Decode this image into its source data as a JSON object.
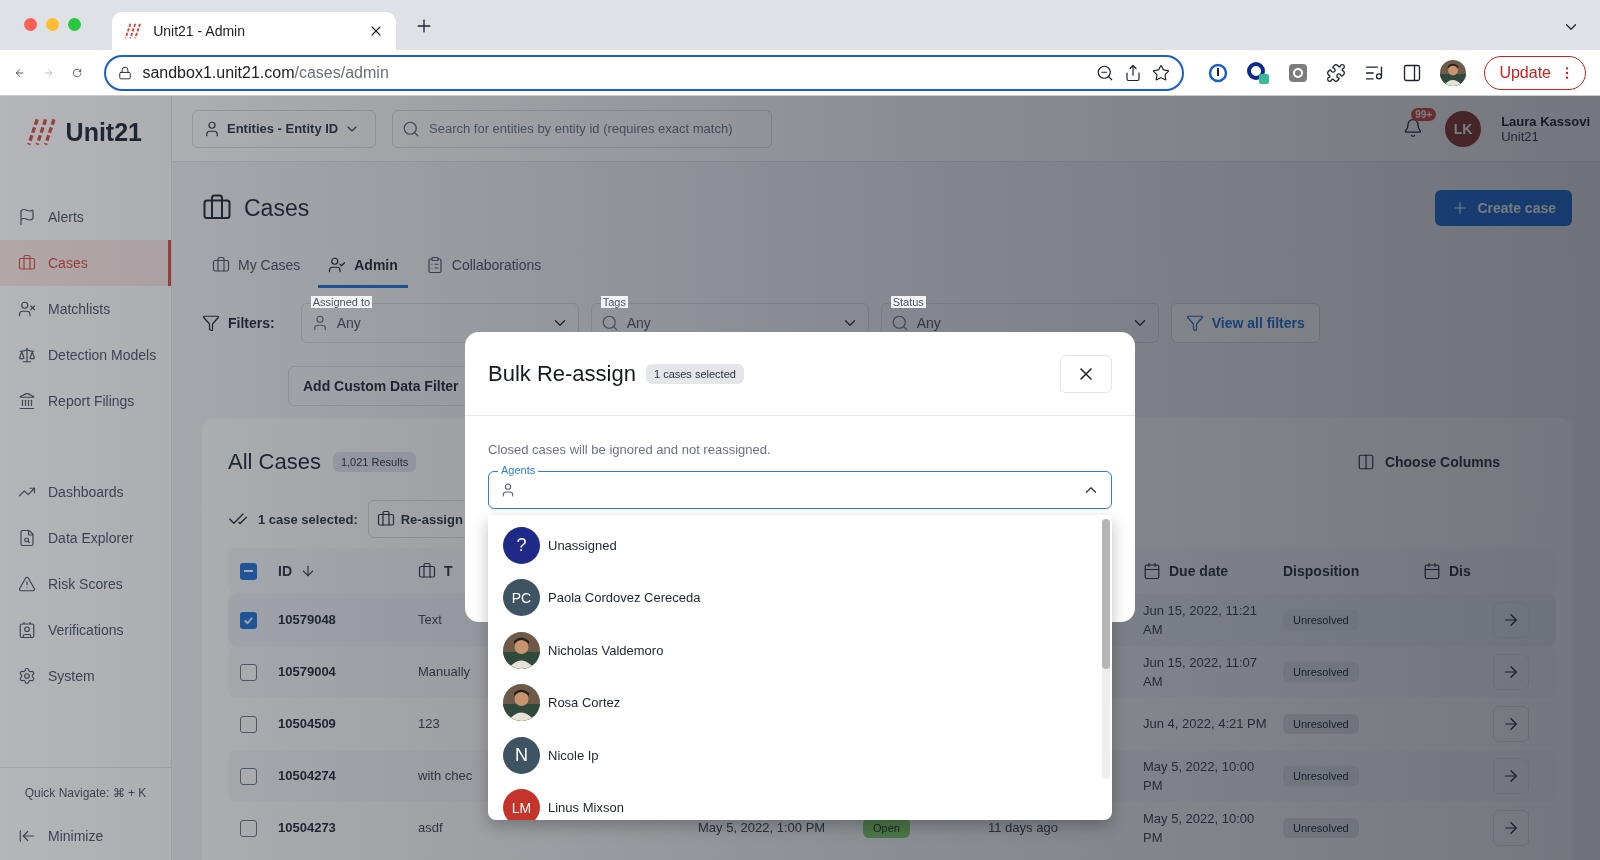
{
  "browser": {
    "tab_title": "Unit21 - Admin",
    "url_host": "sandbox1.unit21.com",
    "url_path": "/cases/admin",
    "update_button": "Update"
  },
  "sidebar": {
    "logo": "Unit21",
    "sections": [
      {
        "items": [
          {
            "label": "Alerts",
            "selected": false
          },
          {
            "label": "Cases",
            "selected": true
          },
          {
            "label": "Matchlists",
            "selected": false
          },
          {
            "label": "Detection Models",
            "selected": false
          },
          {
            "label": "Report Filings",
            "selected": false
          }
        ]
      },
      {
        "items": [
          {
            "label": "Dashboards",
            "selected": false
          },
          {
            "label": "Data Explorer",
            "selected": false
          },
          {
            "label": "Risk Scores",
            "selected": false
          },
          {
            "label": "Verifications",
            "selected": false
          },
          {
            "label": "System",
            "selected": false
          }
        ]
      }
    ],
    "quick_navigate": "Quick Navigate: ⌘ + K",
    "minimize": "Minimize"
  },
  "topbar": {
    "entity_selector": "Entities - Entity ID",
    "search": {
      "placeholder": "Search for entities by entity id (requires exact match)"
    },
    "notifications_badge": "99+",
    "user": {
      "initials": "LK",
      "name": "Laura Kassovi",
      "org": "Unit21"
    }
  },
  "page": {
    "title": "Cases",
    "create_button": "Create case",
    "tabs": [
      {
        "label": "My Cases",
        "selected": false
      },
      {
        "label": "Admin",
        "selected": true
      },
      {
        "label": "Collaborations",
        "selected": false
      }
    ],
    "filters": {
      "label": "Filters:",
      "fields": [
        {
          "label": "Assigned to",
          "value": "Any"
        },
        {
          "label": "Tags",
          "value": "Any"
        },
        {
          "label": "Status",
          "value": "Any"
        }
      ],
      "view_all": "View all filters",
      "add_custom": "Add Custom Data Filter"
    },
    "card": {
      "title": "All Cases",
      "results_badge": "1,021 Results",
      "choose_columns": "Choose Columns",
      "selection_text": "1 case selected:",
      "reassign_button": "Re-assign",
      "table": {
        "select_all": {
          "indeterminate": true
        },
        "columns": {
          "id": "ID",
          "type": "T",
          "due_date": "Due date",
          "disposition": "Disposition",
          "column_dis": "Dis"
        },
        "rows": [
          {
            "checked": true,
            "id": "10579048",
            "type": "Text",
            "due_date": "Jun 15, 2022, 11:21 AM",
            "disposition": "Unresolved"
          },
          {
            "checked": false,
            "id": "10579004",
            "type": "Manually",
            "due_date": "Jun 15, 2022, 11:07 AM",
            "disposition": "Unresolved"
          },
          {
            "checked": false,
            "id": "10504509",
            "type": "123",
            "due_date": "Jun 4, 2022, 4:21 PM",
            "disposition": "Unresolved"
          },
          {
            "checked": false,
            "id": "10504274",
            "type": "with chec",
            "due_date": "May 5, 2022, 10:00 PM",
            "disposition": "Unresolved"
          },
          {
            "checked": false,
            "id": "10504273",
            "type": "asdf",
            "created": "May 5, 2022, 1:00 PM",
            "status": "Open",
            "age": "11 days ago",
            "due_date": "May 5, 2022, 10:00 PM",
            "disposition": "Unresolved"
          }
        ]
      }
    }
  },
  "modal": {
    "title": "Bulk Re-assign",
    "badge": "1 cases selected",
    "note": "Closed cases will be ignored and not reassigned.",
    "agents_field": {
      "label": "Agents",
      "expanded": true
    },
    "options": [
      {
        "kind": "initials",
        "avatar_text": "?",
        "color": "#1f2a86",
        "name": "Unassigned"
      },
      {
        "kind": "initials",
        "avatar_text": "PC",
        "color": "#3f5462",
        "name": "Paola Cordovez Cereceda"
      },
      {
        "kind": "picture",
        "name": "Nicholas Valdemoro"
      },
      {
        "kind": "picture",
        "name": "Rosa Cortez"
      },
      {
        "kind": "initials",
        "avatar_text": "N",
        "color": "#3f5462",
        "name": "Nicole Ip"
      },
      {
        "kind": "initials",
        "avatar_text": "LM",
        "color": "#c4342a",
        "name": "Linus Mixson"
      }
    ]
  }
}
